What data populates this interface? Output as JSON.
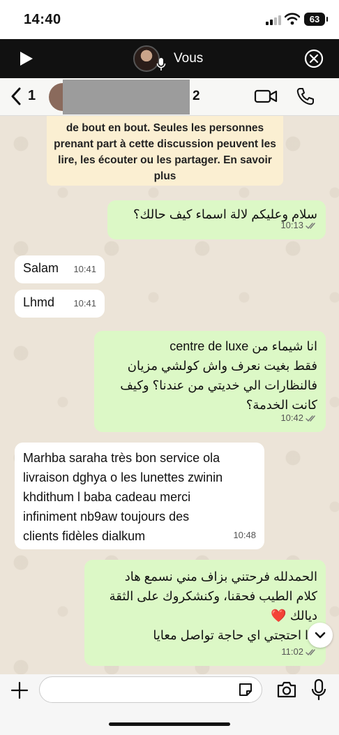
{
  "status_bar": {
    "time": "14:40",
    "battery": "63"
  },
  "voice_banner": {
    "title": "Vous"
  },
  "header": {
    "back_count": "1",
    "name_tail": "2"
  },
  "encryption_notice": {
    "text_before": "de bout en bout. Seules les personnes prenant part à cette discussion peuvent les lire, les écouter ou les partager. ",
    "link": "En savoir plus"
  },
  "messages": [
    {
      "direction": "out",
      "text": "سلام وعليكم لالة اسماء كيف حالك؟",
      "time": "10:13"
    },
    {
      "direction": "in",
      "text": "Salam",
      "time": "10:41"
    },
    {
      "direction": "in",
      "text": "Lhmd",
      "time": "10:41"
    },
    {
      "direction": "out",
      "text": "انا شيماء من centre de luxe\nفقط بغيت نعرف واش كولشي مزيان\nفالنظارات الي خديتي من عندنا؟ وكيف\nكانت الخدمة؟",
      "time": "10:42"
    },
    {
      "direction": "in",
      "text": "Marhba saraha très bon service ola\nlivraison dghya o les lunettes zwinin\nkhdithum l baba cadeau merci\ninfiniment nb9aw toujours des\nclients fidèles dialkum",
      "time": "10:48"
    },
    {
      "direction": "out",
      "text": "الحمدلله  فرحتني  بزاف مني نسمع هاد\nكلام الطيب فحقنا، وكنشكروك على الثقة\nديالك ❤️\nإذا احتجتي اي حاجة تواصل معايا",
      "time": "11:02"
    }
  ],
  "colors": {
    "outgoing_bubble": "#dcf8c6",
    "incoming_bubble": "#ffffff",
    "notice": "#fbefd2",
    "chat_bg": "#ece4d8"
  },
  "icons": [
    "play-icon",
    "mic-icon",
    "close-circle-icon",
    "chevron-left-icon",
    "video-camera-icon",
    "phone-icon",
    "double-check-icon",
    "chevron-down-icon",
    "plus-icon",
    "sticker-icon",
    "camera-icon",
    "microphone-icon"
  ]
}
